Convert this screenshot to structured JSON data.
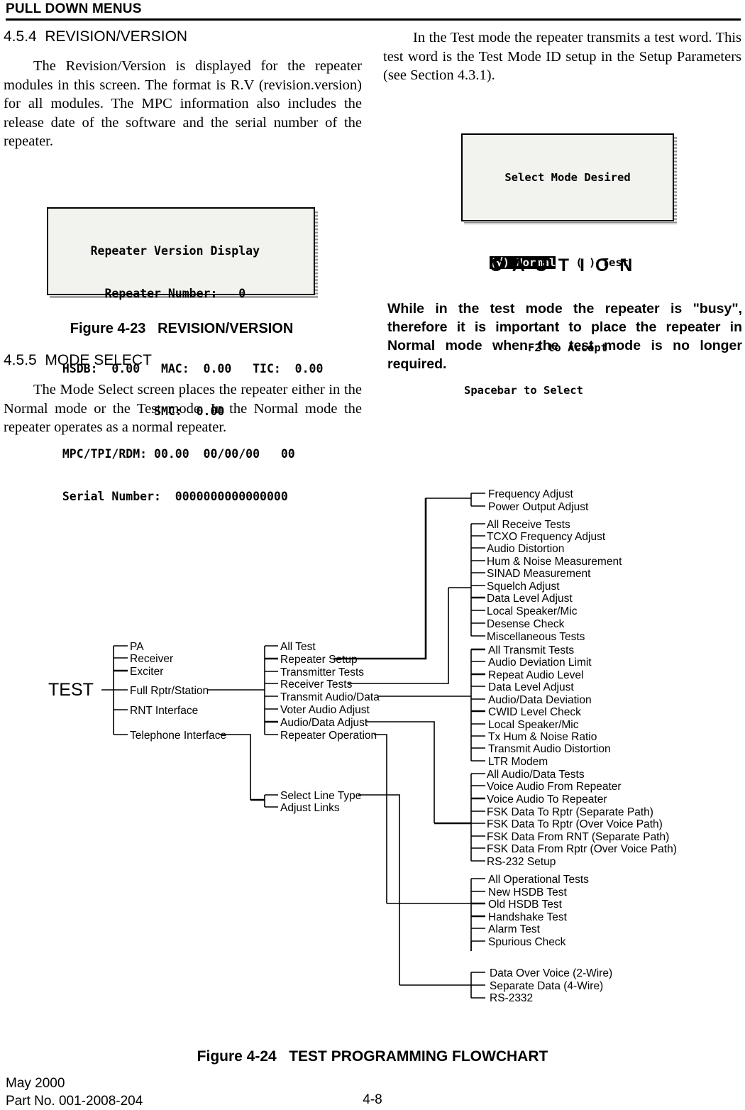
{
  "running_head": "PULL DOWN MENUS",
  "left_column": {
    "section_454_heading": "4.5.4  REVISION/VERSION",
    "section_454_body": "The Revision/Version is displayed for the repeater modules in this screen.  The format is R.V (revision.version) for all modules.  The MPC information also includes the release date of the software and the serial number of the repeater.",
    "figure_423_caption": "Figure 4-23   REVISION/VERSION",
    "section_455_heading": "4.5.5  MODE SELECT",
    "section_455_body": "The Mode Select screen places the repeater either in the Normal mode or the Test mode.  In the Normal mode the repeater operates as a normal repeater."
  },
  "right_column": {
    "intro_body": "In the Test mode the repeater transmits a test word.  This test word is the Test Mode ID setup in the Setup Parameters (see Section 4.3.1).",
    "caution_title": "C A U T I O N",
    "caution_body": "While in the test mode the repeater is \"busy\", therefore it is important to place the repeater in Normal mode when the test mode is no longer required."
  },
  "lcd_version_screen": {
    "title": "Repeater Version Display",
    "repeater_number_label": "Repeater Number:",
    "repeater_number_value": "0",
    "hsdb_label": "HSDB:",
    "hsdb_value": "0.00",
    "mac_label": "MAC:",
    "mac_value": "0.00",
    "tic_label": "TIC:",
    "tic_value": "0.00",
    "smc_label": "SMC:",
    "smc_value": "0.00",
    "mpc_label": "MPC/TPI/RDM:",
    "mpc_value": "00.00",
    "mpc_date": "00/00/00",
    "mpc_rdm": "00",
    "serial_label": "Serial Number:",
    "serial_value": "0000000000000000",
    "line1": "      Repeater Version Display",
    "line2": "        Repeater Number:   0",
    "line3": "  HSDB:  0.00   MAC:  0.00   TIC:  0.00",
    "line4": "               SMC:  0.00",
    "line5": "  MPC/TPI/RDM: 00.00  00/00/00   00",
    "line6": "  Serial Number:  0000000000000000"
  },
  "lcd_mode_screen": {
    "title": "Select Mode Desired",
    "option_normal": "(√) Normal",
    "option_test": "( ) Test",
    "accept_hint": "F2 to Accept",
    "select_hint": "Spacebar to Select"
  },
  "figure_424_caption": "Figure 4-24   TEST PROGRAMMING FLOWCHART",
  "footer": {
    "date": "May 2000",
    "part_no": "Part No. 001-2008-204",
    "page_no": "4-8"
  },
  "flowchart": {
    "root": "TEST",
    "level1": [
      "PA",
      "Receiver",
      "Exciter",
      "Full Rptr/Station",
      "RNT Interface",
      "Telephone Interface"
    ],
    "level2_main": [
      "All Test",
      "Repeater Setup",
      "Transmitter Tests",
      "Receiver Tests",
      "Transmit Audio/Data",
      "Voter Audio Adjust",
      "Audio/Data Adjust",
      "Repeater Operation"
    ],
    "level2_phone": [
      "Select Line Type",
      "Adjust Links"
    ],
    "group_transmitter_setup": [
      "Frequency Adjust",
      "Power Output Adjust"
    ],
    "group_receiver_tests": [
      "All Receive Tests",
      "TCXO Frequency Adjust",
      "Audio Distortion",
      "Hum & Noise Measurement",
      "SINAD Measurement",
      "Squelch Adjust",
      "Data Level Adjust",
      "Local Speaker/Mic",
      "Desense Check",
      "Miscellaneous Tests"
    ],
    "group_transmit_tests": [
      "All Transmit Tests",
      "Audio Deviation Limit",
      "Repeat Audio Level",
      "Data Level Adjust",
      "Audio/Data Deviation",
      "CWID Level Check",
      "Local Speaker/Mic",
      "Tx Hum & Noise Ratio",
      "Transmit Audio Distortion",
      "LTR Modem"
    ],
    "group_audio_data": [
      "All Audio/Data Tests",
      "Voice Audio From Repeater",
      "Voice Audio To Repeater",
      "FSK Data To Rptr (Separate Path)",
      "FSK Data To Rptr (Over Voice Path)",
      "FSK Data From RNT (Separate Path)",
      "FSK Data From Rptr (Over Voice Path)",
      "RS-232 Setup"
    ],
    "group_operational": [
      "All Operational Tests",
      "New HSDB Test",
      "Old HSDB Test",
      "Handshake Test",
      "Alarm Test",
      "Spurious Check"
    ],
    "group_line_type": [
      "Data Over Voice (2-Wire)",
      "Separate Data (4-Wire)",
      "RS-2332"
    ]
  }
}
